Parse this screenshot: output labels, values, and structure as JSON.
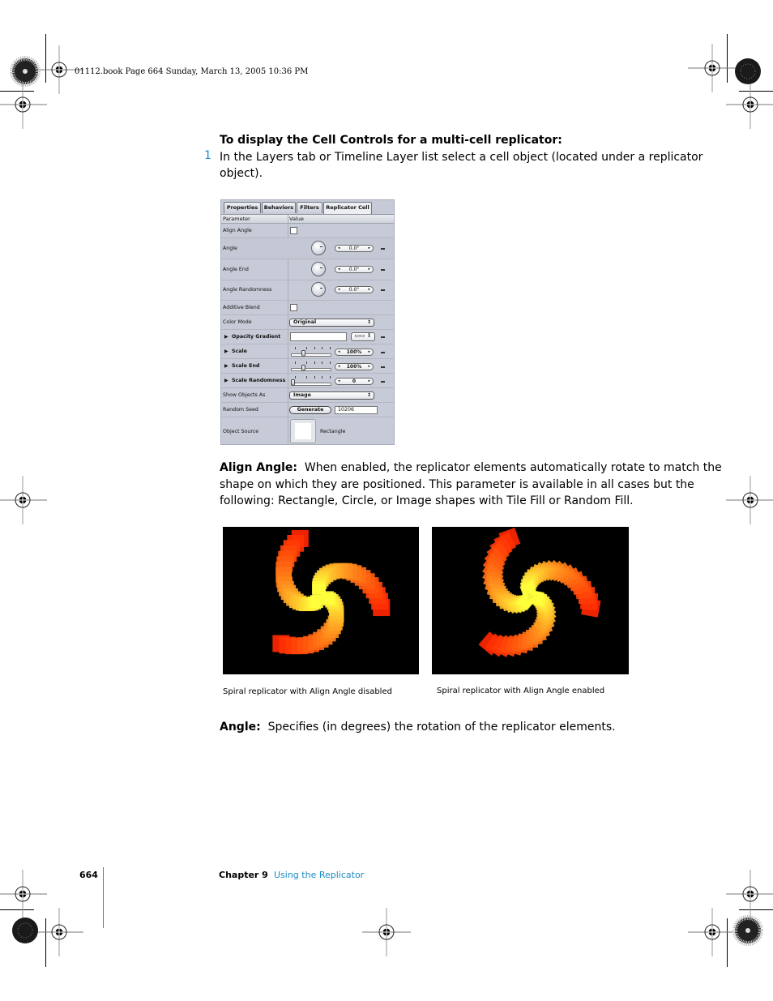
{
  "print_header": {
    "stamp": "01112.book  Page 664  Sunday, March 13, 2005  10:36 PM"
  },
  "procedure": {
    "heading": "To display the Cell Controls for a multi-cell replicator:",
    "steps": [
      {
        "number": "1",
        "text_line1": "In the Layers tab or Timeline Layer list select a cell object (located under a replicator",
        "text_line2": "object)."
      }
    ]
  },
  "inspector": {
    "tabs": [
      {
        "label": "Properties",
        "active": false
      },
      {
        "label": "Behaviors",
        "active": false
      },
      {
        "label": "Filters",
        "active": false
      },
      {
        "label": "Replicator Cell",
        "active": true
      }
    ],
    "columns": {
      "parameter": "Parameter",
      "value": "Value"
    },
    "rows": [
      {
        "label": "Align Angle",
        "control": "checkbox",
        "checked": false
      },
      {
        "label": "Angle",
        "control": "dial",
        "value": "0.0°"
      },
      {
        "label": "Angle End",
        "control": "dial",
        "value": "0.0°"
      },
      {
        "label": "Angle Randomness",
        "control": "dial",
        "value": "0.0°"
      },
      {
        "label": "Additive Blend",
        "control": "checkbox",
        "checked": false
      },
      {
        "label": "Color Mode",
        "control": "popup",
        "value": "Original"
      },
      {
        "label": "Opacity Gradient",
        "control": "gradient",
        "expandable": true,
        "preset_icon": "gradient-presets-icon"
      },
      {
        "label": "Scale",
        "control": "slider",
        "expandable": true,
        "value": "100%",
        "slider_fraction": 0.3
      },
      {
        "label": "Scale End",
        "control": "slider",
        "expandable": true,
        "value": "100%",
        "slider_fraction": 0.3
      },
      {
        "label": "Scale Randomness",
        "control": "slider",
        "expandable": true,
        "value": "0",
        "slider_fraction": 0.0
      },
      {
        "label": "Show Objects As",
        "control": "popup",
        "value": "Image"
      },
      {
        "label": "Random Seed",
        "control": "button",
        "button_label": "Generate",
        "value": "10206"
      },
      {
        "label": "Object Source",
        "control": "well",
        "value": "Rectangle"
      }
    ]
  },
  "align_angle": {
    "term": "Align Angle:",
    "line1": "When enabled, the replicator elements automatically rotate to match the",
    "line2": "shape on which they are positioned. This parameter is available in all cases but the",
    "line3": "following:  Rectangle, Circle, or Image shapes with Tile Fill or Random Fill."
  },
  "figures": [
    {
      "caption": "Spiral replicator with Align Angle disabled",
      "aligned": false
    },
    {
      "caption": "Spiral replicator with Align Angle enabled",
      "aligned": true
    }
  ],
  "angle": {
    "term": "Angle:",
    "text": "Specifies (in degrees) the rotation of the replicator elements."
  },
  "footer": {
    "page_number": "664",
    "chapter_label": "Chapter 9",
    "chapter_title": "Using the Replicator"
  },
  "colors": {
    "accent_blue": "#1a8bc7",
    "panel_bg": "#c6cbd7"
  }
}
